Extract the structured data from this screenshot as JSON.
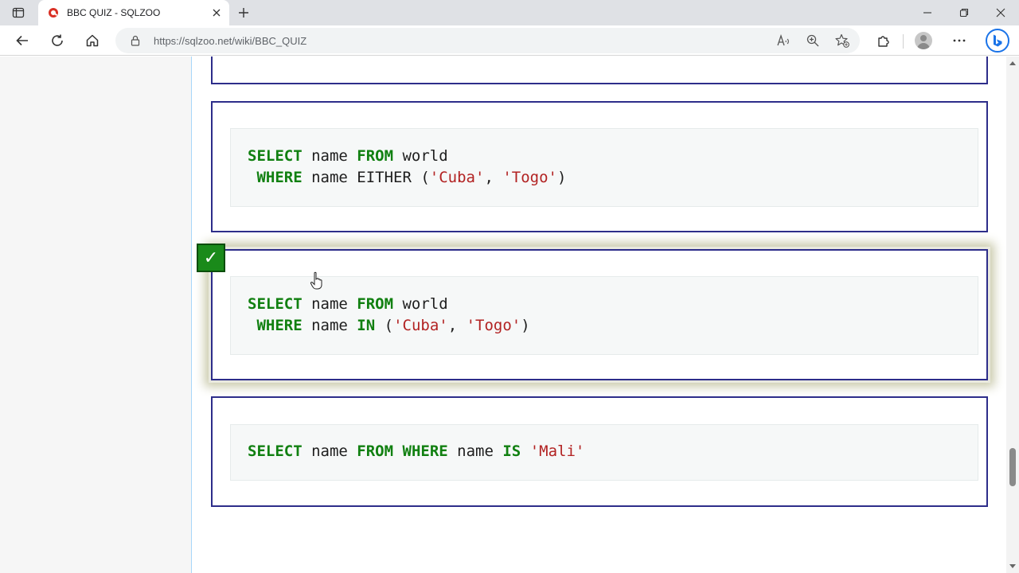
{
  "browser": {
    "tab_title": "BBC QUIZ - SQLZOO",
    "url": "https://sqlzoo.net/wiki/BBC_QUIZ"
  },
  "quiz": {
    "options": [
      {
        "line1": {
          "kw1": "SELECT",
          "t1": " name ",
          "kw2": "FROM",
          "t2": " world"
        },
        "line2": {
          "kw1": " WHERE",
          "t1": " name EITHER (",
          "s1": "'Cuba'",
          "t2": ", ",
          "s2": "'Togo'",
          "t3": ")"
        }
      },
      {
        "selected": true,
        "line1": {
          "kw1": "SELECT",
          "t1": " name ",
          "kw2": "FROM",
          "t2": " world"
        },
        "line2": {
          "kw1": " WHERE",
          "t1": " name ",
          "kw3": "IN",
          "t2": " (",
          "s1": "'Cuba'",
          "t3": ", ",
          "s2": "'Togo'",
          "t4": ")"
        }
      },
      {
        "line1": {
          "kw1": "SELECT",
          "t1": " name ",
          "kw2": "FROM",
          "t2": " ",
          "kw3": "WHERE",
          "t3": " name ",
          "kw4": "IS",
          "t4": " ",
          "s1": "'Mali'"
        }
      }
    ],
    "selected_mark": "✓"
  },
  "colors": {
    "keyword": "#118011",
    "string": "#b22222",
    "answer_border": "#2d2d8a",
    "selected_mark_bg": "#1a8a1a"
  },
  "icons": [
    "sidebar-toggle-icon",
    "favicon-icon",
    "close-icon",
    "plus-icon",
    "minimize-icon",
    "restore-icon",
    "back-icon",
    "refresh-icon",
    "home-icon",
    "lock-icon",
    "read-aloud-icon",
    "zoom-icon",
    "favorites-icon",
    "extensions-icon",
    "more-icon",
    "bing-icon"
  ]
}
